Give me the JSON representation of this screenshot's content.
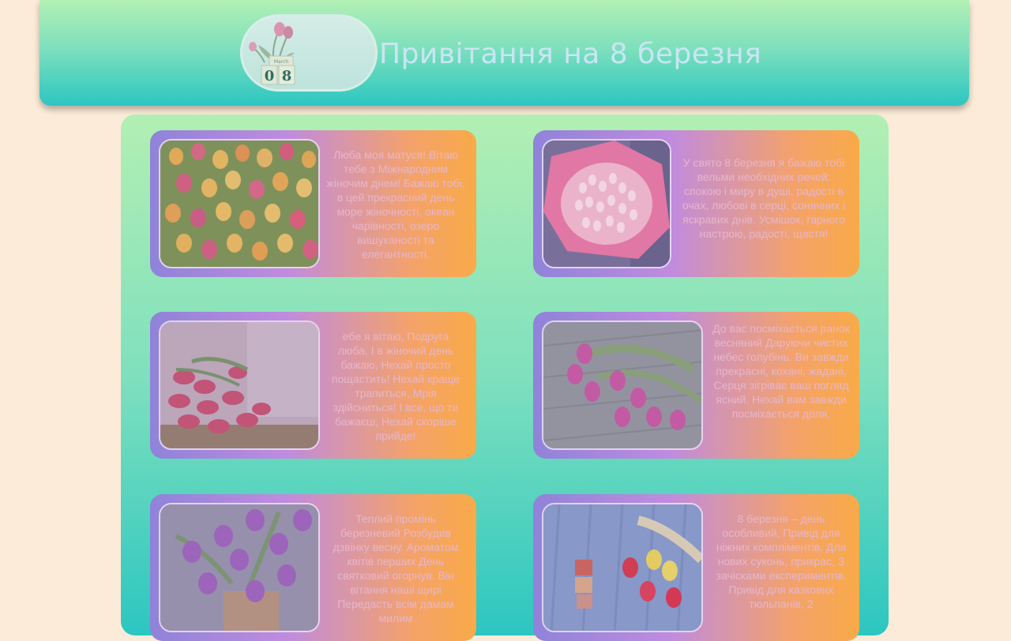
{
  "header": {
    "title": "Привітання на 8 березня",
    "logo": {
      "digits": "08",
      "label": "March"
    }
  },
  "cards": [
    {
      "image": "tulip-field-photo",
      "text": "Люба моя матуся! Вітаю тебе з Міжнародним жіночим днем! Бажаю тобі, в цей прекрасний день море жіночності, океан чарівності, озеро вишуканості та елегантності."
    },
    {
      "image": "pink-bouquet-photo",
      "text": "У свято 8 березня я бажаю тобі вельми необхідних речей: спокою і миру в душі, радості в очах, любові в серці, сонячних і яскравих днів. Усмішок, гарного настрою, радості, щастя!"
    },
    {
      "image": "red-tulips-photo",
      "text": "ебе я вітаю, Подруга люба, І в жіночий день бажаю, Нехай просто пощастить! Нехай краще трапиться, Мрія здійсниться! І все, що ти бажаєш, Нехай скоріше прийде!"
    },
    {
      "image": "purple-tulips-on-wood-photo",
      "text": "До вас посміхається ранок весняний Даруючи чистих небес голубінь. Ви завжди прекрасні, кохані, жадані, Серця зігріває ваш погляд ясний. Нехай вам завжди посміхається доля,"
    },
    {
      "image": "violet-tulips-photo",
      "text": "Теплий промінь березневий Розбудив дзвінку весну. Ароматом квітів перших День святковий огорнув. Він вітання наші щирі Передасть всім дамам милим"
    },
    {
      "image": "tulips-and-gifts-photo",
      "text": "8 березня – день особливий, Привід для ніжних компліментів, Для нових суконь, прикрас, З зачісками експериментів. Привід для казкових тюльпанів, 2"
    }
  ],
  "colors": {
    "page_bg": "#fbebd8",
    "header_top": "#b2f0b4",
    "header_bottom": "#2cc6c1",
    "title": "#c9e6f3",
    "card_left": "#8f83d9",
    "card_right": "#f9aa48",
    "card_text": "#e7b6cc"
  }
}
